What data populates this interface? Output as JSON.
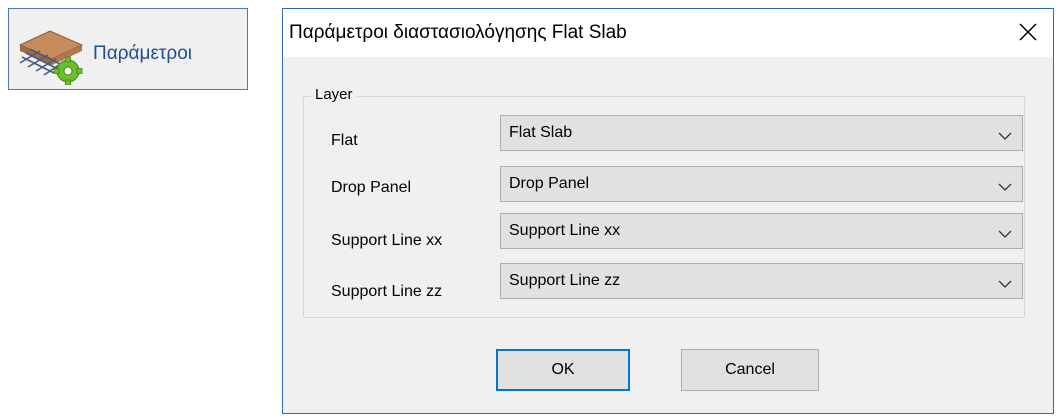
{
  "ribbon": {
    "button_label": "Παράμετροι",
    "icon": "flat-slab-settings-icon"
  },
  "dialog": {
    "title": "Παράμετροι διαστασιολόγησης Flat Slab",
    "close_icon": "close-icon",
    "group_title": "Layer",
    "fields": [
      {
        "label": "Flat",
        "value": "Flat Slab"
      },
      {
        "label": "Drop Panel",
        "value": "Drop Panel"
      },
      {
        "label": "Support Line xx",
        "value": "Support Line xx"
      },
      {
        "label": "Support Line zz",
        "value": "Support Line zz"
      }
    ],
    "ok_label": "OK",
    "cancel_label": "Cancel"
  },
  "colors": {
    "accent": "#0078d7",
    "window_bg": "#f0f0f0",
    "combo_bg": "#e1e1e1",
    "ribbon_border": "#4a7ab8"
  }
}
